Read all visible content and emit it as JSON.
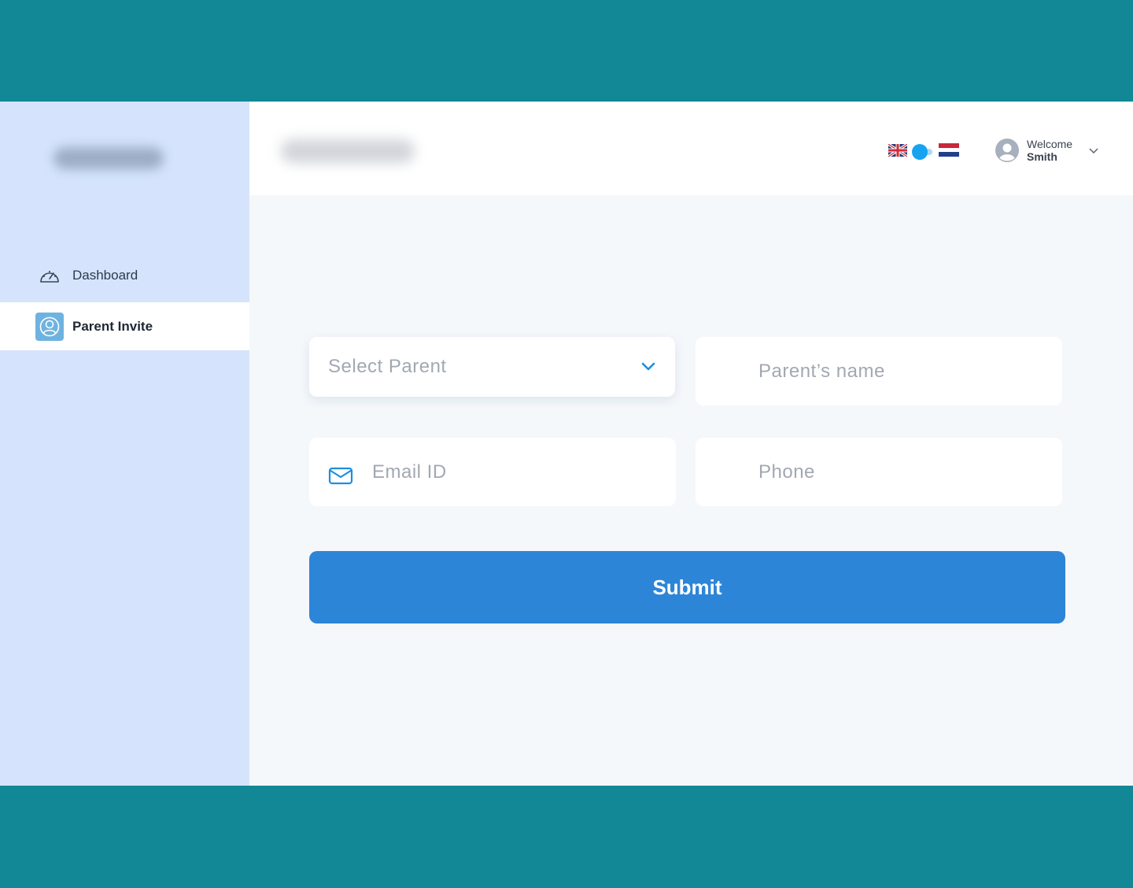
{
  "sidebar": {
    "items": [
      {
        "label": "Dashboard",
        "icon": "speedometer-icon",
        "active": false
      },
      {
        "label": "Parent Invite",
        "icon": "user-circle-icon",
        "active": true
      }
    ]
  },
  "header": {
    "language_toggle": {
      "left_flag": "uk-flag-icon",
      "right_flag": "netherlands-flag-icon"
    },
    "user": {
      "greeting": "Welcome",
      "name": "Smith"
    }
  },
  "form": {
    "select_parent": {
      "placeholder": "Select Parent"
    },
    "parent_name": {
      "placeholder": "Parent’s name"
    },
    "email": {
      "placeholder": "Email ID"
    },
    "phone": {
      "placeholder": "Phone"
    },
    "submit_label": "Submit"
  },
  "colors": {
    "accent": "#2d85d7",
    "band": "#128795",
    "sidebar_bg": "#d5e4fc",
    "toggle": "#16a4f0"
  }
}
